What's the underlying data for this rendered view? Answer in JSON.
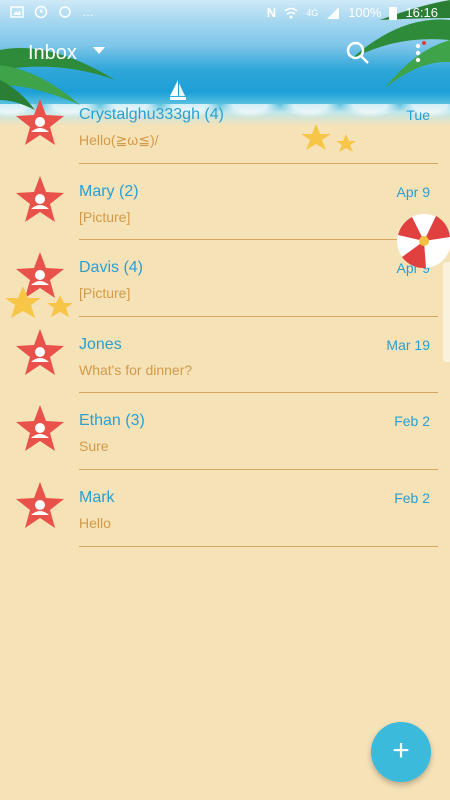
{
  "status_bar": {
    "battery": "100%",
    "time": "16:16",
    "network": "4G"
  },
  "app_bar": {
    "title": "Inbox"
  },
  "conversations": [
    {
      "name": "Crystalghu333gh (4)",
      "date": "Tue",
      "snippet": "Hello(≧ω≦)/"
    },
    {
      "name": "Mary (2)",
      "date": "Apr 9",
      "snippet": "[Picture]"
    },
    {
      "name": "Davis (4)",
      "date": "Apr 9",
      "snippet": "[Picture]"
    },
    {
      "name": "Jones",
      "date": "Mar 19",
      "snippet": "What's for dinner?"
    },
    {
      "name": "Ethan (3)",
      "date": "Feb 2",
      "snippet": "Sure"
    },
    {
      "name": "Mark",
      "date": "Feb 2",
      "snippet": "Hello"
    }
  ],
  "fab": {
    "label": "+"
  },
  "colors": {
    "accent": "#2a9fd0",
    "snippet": "#d39a49",
    "sand": "#f6e2b7",
    "fab": "#3cbadc"
  }
}
